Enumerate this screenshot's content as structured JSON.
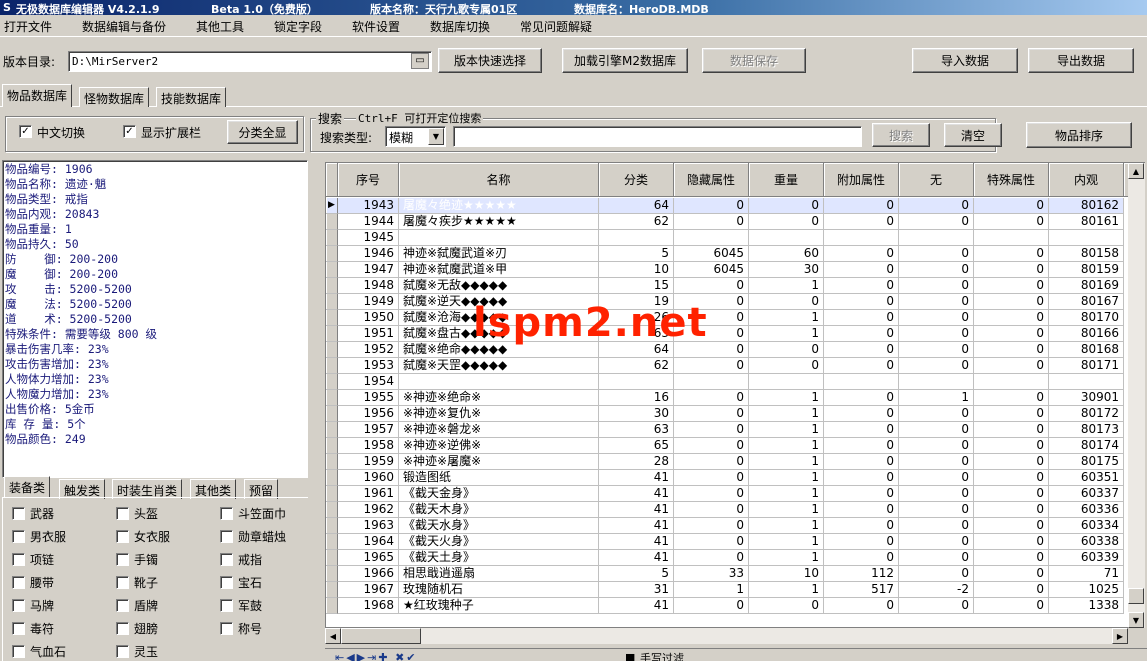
{
  "title": {
    "app": "无极数据库编辑器 V4.2.1.9",
    "edition": "Beta 1.0（免费版）",
    "version_name": "版本名称：天行九歌专属01区",
    "db_name": "数据库名：HeroDB.MDB"
  },
  "menu": [
    "打开文件",
    "数据编辑与备份",
    "其他工具",
    "锁定字段",
    "软件设置",
    "数据库切换",
    "常见问题解疑"
  ],
  "toolbar": {
    "dir_label": "版本目录:",
    "dir_value": "D:\\MirServer2",
    "quick_select": "版本快速选择",
    "load_m2": "加载引擎M2数据库",
    "save": "数据保存",
    "import": "导入数据",
    "export": "导出数据"
  },
  "tabs": [
    "物品数据库",
    "怪物数据库",
    "技能数据库"
  ],
  "options": {
    "chinese_switch": "中文切换",
    "show_ext": "显示扩展栏",
    "show_all": "分类全显"
  },
  "search": {
    "group_label": "搜索",
    "hint": "Ctrl+F 可打开定位搜索",
    "type_label": "搜索类型:",
    "type_value": "模糊",
    "search_btn": "搜索",
    "clear_btn": "清空",
    "sort_btn": "物品排序"
  },
  "item_info": [
    "物品编号: 1906",
    "物品名称: 遗迹·魈",
    "物品类型: 戒指",
    "物品内观: 20843",
    "物品重量: 1",
    "物品持久: 50",
    "防    御: 200-200",
    "魔    御: 200-200",
    "攻    击: 5200-5200",
    "魔    法: 5200-5200",
    "道    术: 5200-5200",
    "特殊条件: 需要等级 800 级",
    "暴击伤害几率: 23%",
    "攻击伤害增加: 23%",
    "人物体力增加: 23%",
    "人物魔力增加: 23%",
    "出售价格: 5金币",
    "库 存 量: 5个",
    "物品颜色: 249"
  ],
  "category_tabs": [
    "装备类",
    "触发类",
    "时装生肖类",
    "其他类",
    "预留"
  ],
  "categories": [
    [
      "武器",
      "头盔",
      "斗笠面巾"
    ],
    [
      "男衣服",
      "女衣服",
      "勋章蜡烛"
    ],
    [
      "项链",
      "手镯",
      "戒指"
    ],
    [
      "腰带",
      "靴子",
      "宝石"
    ],
    [
      "马牌",
      "盾牌",
      "军鼓"
    ],
    [
      "毒符",
      "翅膀",
      "称号"
    ],
    [
      "气血石",
      "灵玉",
      ""
    ]
  ],
  "grid": {
    "headers": [
      "序号",
      "名称",
      "分类",
      "隐藏属性",
      "重量",
      "附加属性",
      "无",
      "特殊属性",
      "内观"
    ],
    "rows": [
      [
        "1943",
        "屠魔々绝迹★★★★★",
        "64",
        "0",
        "0",
        "0",
        "0",
        "0",
        "80162"
      ],
      [
        "1944",
        "屠魔々疾步★★★★★",
        "62",
        "0",
        "0",
        "0",
        "0",
        "0",
        "80161"
      ],
      [
        "1945",
        "",
        "",
        "",
        "",
        "",
        "",
        "",
        ""
      ],
      [
        "1946",
        "神迹※弑魔武道※刃",
        "5",
        "6045",
        "60",
        "0",
        "0",
        "0",
        "80158"
      ],
      [
        "1947",
        "神迹※弑魔武道※甲",
        "10",
        "6045",
        "30",
        "0",
        "0",
        "0",
        "80159"
      ],
      [
        "1948",
        "弑魔※无敌◆◆◆◆◆",
        "15",
        "0",
        "1",
        "0",
        "0",
        "0",
        "80169"
      ],
      [
        "1949",
        "弑魔※逆天◆◆◆◆◆",
        "19",
        "0",
        "0",
        "0",
        "0",
        "0",
        "80167"
      ],
      [
        "1950",
        "弑魔※沧海◆◆◆◆◆",
        "26",
        "0",
        "1",
        "0",
        "0",
        "0",
        "80170"
      ],
      [
        "1951",
        "弑魔※盘古◆◆◆◆◆",
        "63",
        "0",
        "1",
        "0",
        "0",
        "0",
        "80166"
      ],
      [
        "1952",
        "弑魔※绝命◆◆◆◆◆",
        "64",
        "0",
        "0",
        "0",
        "0",
        "0",
        "80168"
      ],
      [
        "1953",
        "弑魔※天罡◆◆◆◆◆",
        "62",
        "0",
        "0",
        "0",
        "0",
        "0",
        "80171"
      ],
      [
        "1954",
        "",
        "",
        "",
        "",
        "",
        "",
        "",
        ""
      ],
      [
        "1955",
        "※神迹※绝命※",
        "16",
        "0",
        "1",
        "0",
        "1",
        "0",
        "30901"
      ],
      [
        "1956",
        "※神迹※复仇※",
        "30",
        "0",
        "1",
        "0",
        "0",
        "0",
        "80172"
      ],
      [
        "1957",
        "※神迹※磐龙※",
        "63",
        "0",
        "1",
        "0",
        "0",
        "0",
        "80173"
      ],
      [
        "1958",
        "※神迹※逆佛※",
        "65",
        "0",
        "1",
        "0",
        "0",
        "0",
        "80174"
      ],
      [
        "1959",
        "※神迹※屠魔※",
        "28",
        "0",
        "1",
        "0",
        "0",
        "0",
        "80175"
      ],
      [
        "1960",
        "锻造图纸",
        "41",
        "0",
        "1",
        "0",
        "0",
        "0",
        "60351"
      ],
      [
        "1961",
        "《截天金身》",
        "41",
        "0",
        "1",
        "0",
        "0",
        "0",
        "60337"
      ],
      [
        "1962",
        "《截天木身》",
        "41",
        "0",
        "1",
        "0",
        "0",
        "0",
        "60336"
      ],
      [
        "1963",
        "《截天水身》",
        "41",
        "0",
        "1",
        "0",
        "0",
        "0",
        "60334"
      ],
      [
        "1964",
        "《截天火身》",
        "41",
        "0",
        "1",
        "0",
        "0",
        "0",
        "60338"
      ],
      [
        "1965",
        "《截天土身》",
        "41",
        "0",
        "1",
        "0",
        "0",
        "0",
        "60339"
      ],
      [
        "1966",
        "相思戢逍遥扇",
        "5",
        "33",
        "10",
        "112",
        "0",
        "0",
        "71"
      ],
      [
        "1967",
        "玫瑰随机石",
        "31",
        "1",
        "1",
        "517",
        "-2",
        "0",
        "1025"
      ],
      [
        "1968",
        "★红玫瑰种子",
        "41",
        "0",
        "0",
        "0",
        "0",
        "0",
        "1338"
      ]
    ]
  },
  "bottom_label": "手写过滤",
  "watermark": "lspm2.net"
}
